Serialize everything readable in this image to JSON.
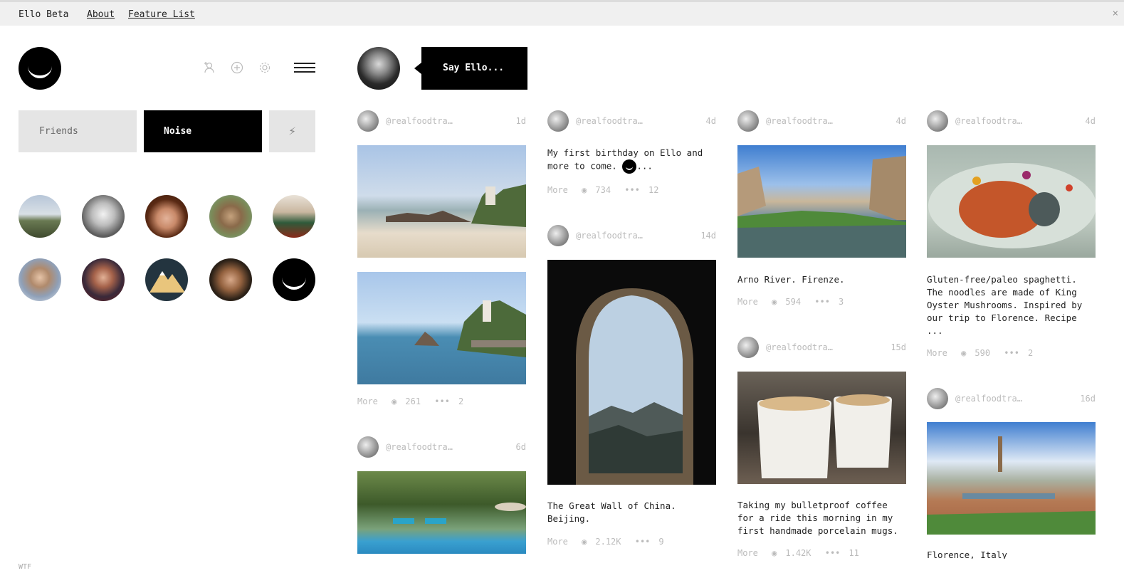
{
  "topbar": {
    "brand": "Ello Beta",
    "about": "About",
    "features": "Feature List",
    "close": "×"
  },
  "sidebar": {
    "icons": [
      "add-person-icon",
      "plus-circle-icon",
      "gear-icon",
      "menu-icon"
    ],
    "tabs": {
      "friends": "Friends",
      "noise": "Noise",
      "bolt": "⚡"
    },
    "footer": "WTF"
  },
  "composer": {
    "placeholder": "Say Ello..."
  },
  "posts": {
    "c1a": {
      "user": "@realfoodtra…",
      "age": "1d",
      "more": "More",
      "views": "261",
      "comments": "2"
    },
    "c1b": {
      "user": "@realfoodtra…",
      "age": "6d"
    },
    "c2a": {
      "user": "@realfoodtra…",
      "age": "4d",
      "text_before": "My first birthday on Ello and more to come.",
      "text_after": "...",
      "more": "More",
      "views": "734",
      "comments": "12"
    },
    "c2b": {
      "user": "@realfoodtra…",
      "age": "14d",
      "text": "The Great Wall of China. Beijing.",
      "more": "More",
      "views": "2.12K",
      "comments": "9"
    },
    "c3a": {
      "user": "@realfoodtra…",
      "age": "4d",
      "text": "Arno River. Firenze.",
      "more": "More",
      "views": "594",
      "comments": "3"
    },
    "c3b": {
      "user": "@realfoodtra…",
      "age": "15d",
      "text": "Taking my bulletproof coffee for a ride this morning in my first handmade porcelain mugs.",
      "more": "More",
      "views": "1.42K",
      "comments": "11"
    },
    "c4a": {
      "user": "@realfoodtra…",
      "age": "4d",
      "text": "Gluten-free/paleo spaghetti. The noodles are made of King Oyster Mushrooms. Inspired by our trip to Florence. Recipe ...",
      "more": "More",
      "views": "590",
      "comments": "2"
    },
    "c4b": {
      "user": "@realfoodtra…",
      "age": "16d",
      "text": "Florence, Italy"
    }
  },
  "colors": {
    "accent": "#000000",
    "muted": "#bbbbbb",
    "tab_bg": "#e5e5e5"
  }
}
